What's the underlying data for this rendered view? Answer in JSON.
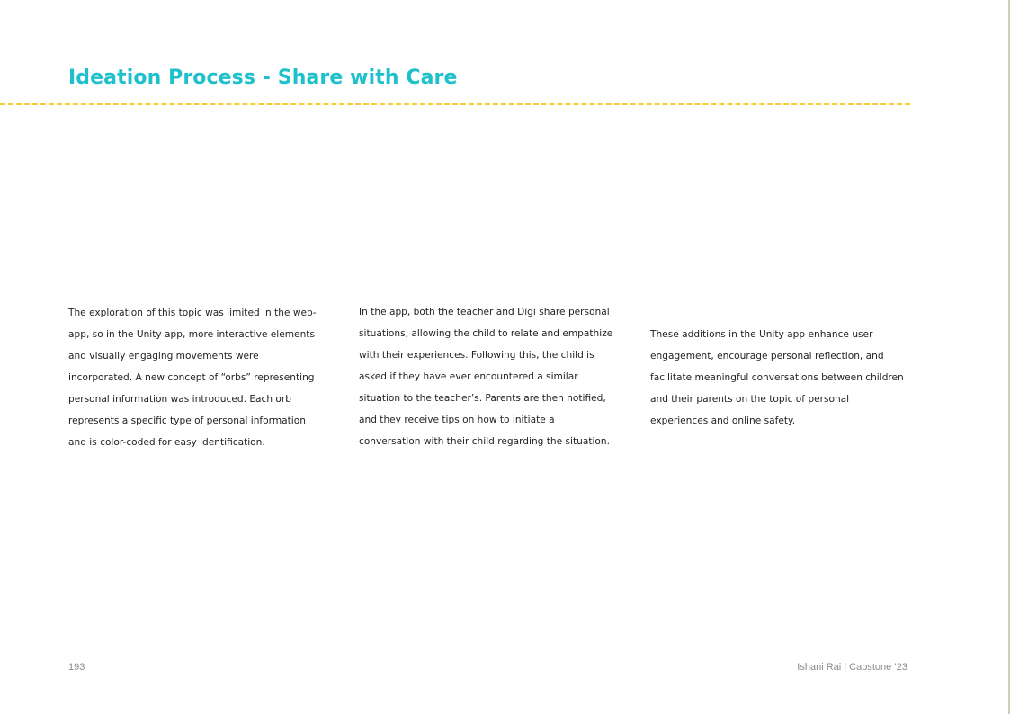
{
  "header": {
    "title": "Ideation Process - Share with Care"
  },
  "body": {
    "columns": [
      "The exploration of this topic was limited in the web-app, so in the Unity app, more interactive elements and visually engaging movements were incorporated. A new concept of “orbs” representing personal information was introduced. Each orb represents a specific type of personal information and is color-coded for easy identification.",
      "In the app, both the teacher and Digi share personal situations, allowing the child to relate and empathize with their experiences. Following this, the child is asked if they have ever encountered a similar situation to the teacher’s. Parents are then notified, and they receive tips on how to initiate a conversation with their child regarding the situation.",
      "These additions in the Unity app enhance user engagement, encourage personal reflection, and facilitate meaningful conversations between children and their parents on the topic of personal experiences and online safety."
    ]
  },
  "footer": {
    "page_number": "193",
    "credit": "Ishani Rai | Capstone ’23"
  },
  "colors": {
    "title": "#1ec0cc",
    "divider": "#f5cc3a",
    "body_text": "#222222",
    "footer_text": "#8a8a8a"
  }
}
